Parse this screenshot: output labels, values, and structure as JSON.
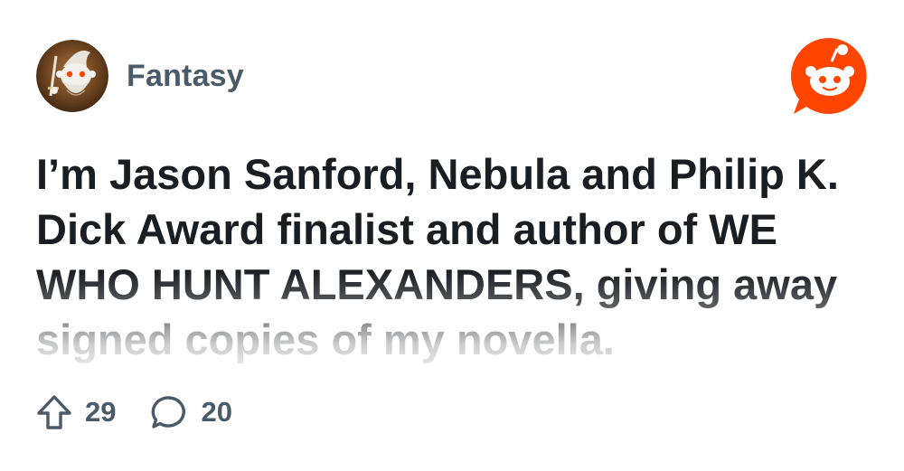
{
  "community": {
    "name": "Fantasy",
    "avatar_icon": "fantasy-wizard-snoo-avatar"
  },
  "brand": {
    "icon": "reddit-snoo-icon",
    "color": "#ff4500"
  },
  "post": {
    "title": "I’m Jason Sanford, Nebula and Philip K. Dick Award finalist and author of WE WHO HUNT ALEXANDERS, giving away signed copies of my novella."
  },
  "actions": {
    "upvote": {
      "icon": "upvote-arrow-icon",
      "count": "29"
    },
    "comments": {
      "icon": "comment-bubble-icon",
      "count": "20"
    }
  },
  "colors": {
    "title_text": "#1a1d21",
    "meta_text": "#4a5a68",
    "background": "#ffffff"
  }
}
